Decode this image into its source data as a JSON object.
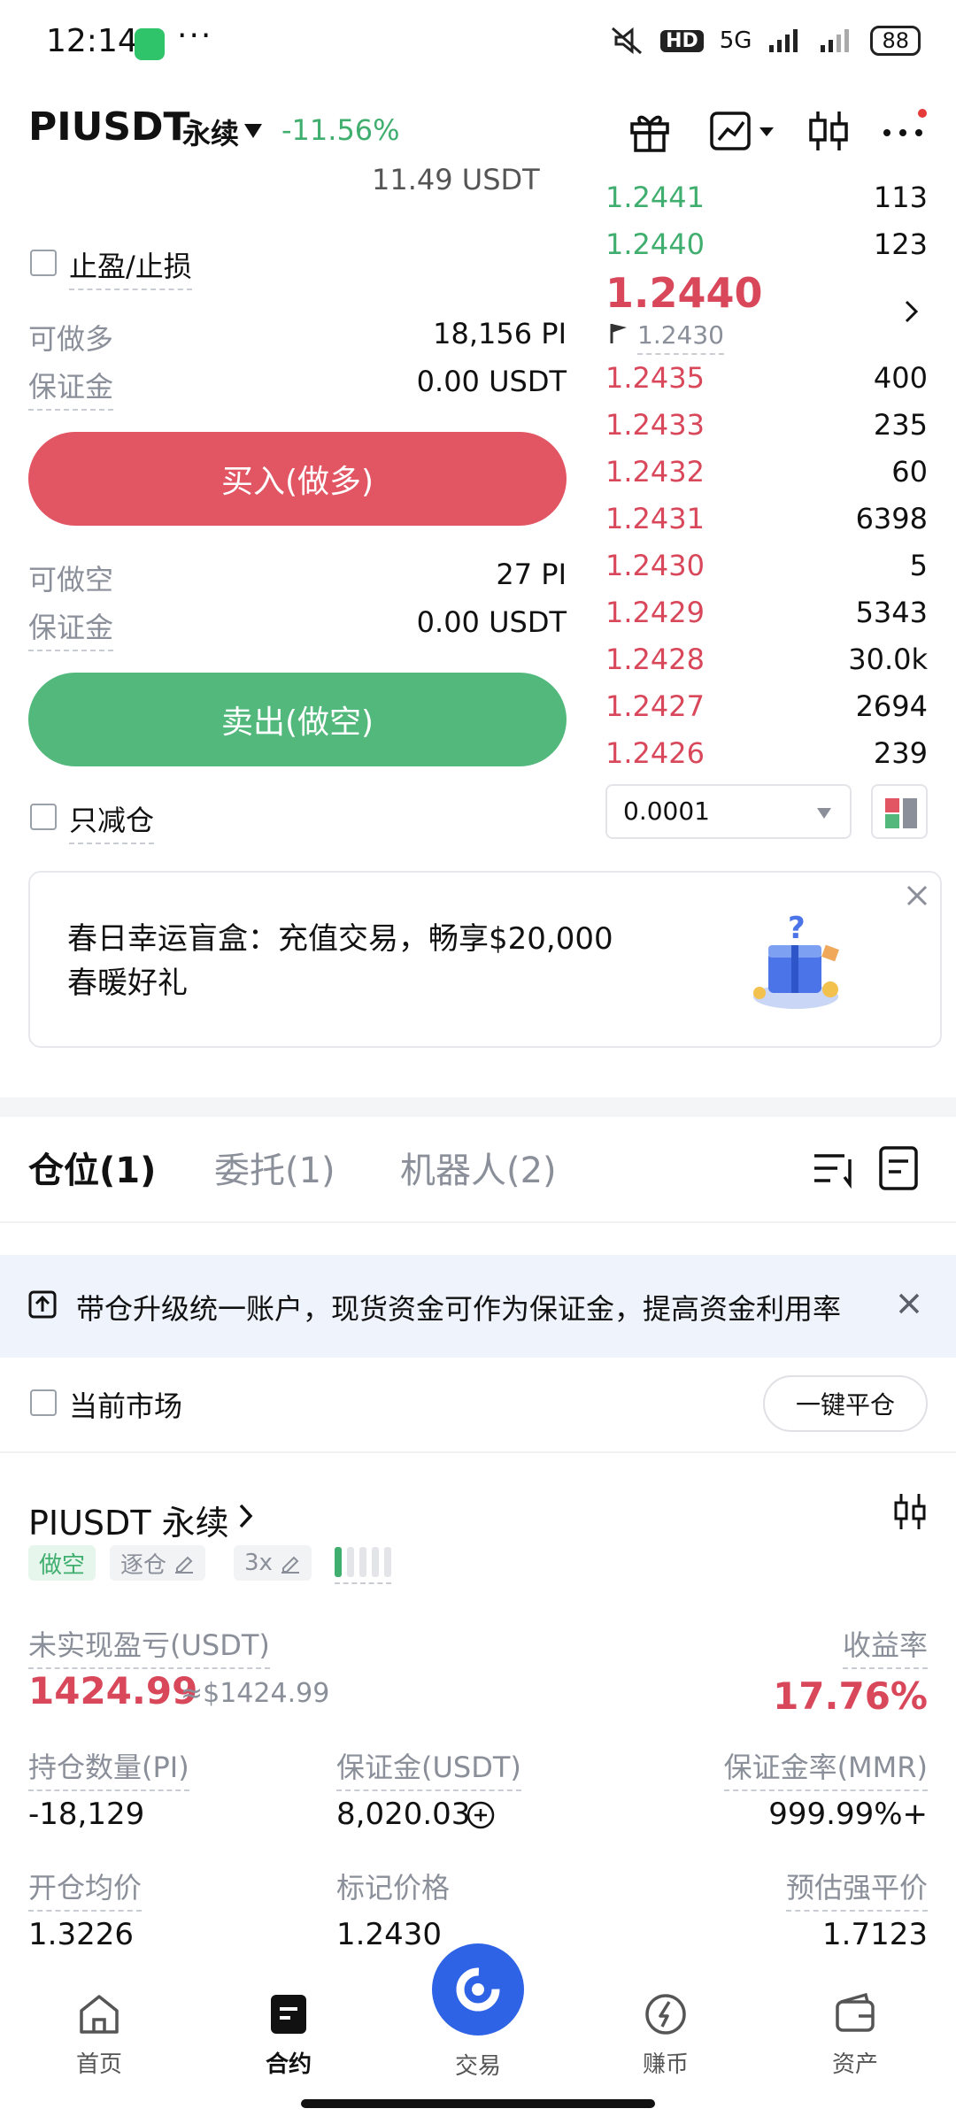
{
  "status_bar": {
    "time": "12:14",
    "network": "5G",
    "hd": "HD",
    "battery": "88"
  },
  "header": {
    "pair": "PIUSDT",
    "contract_type": "永续",
    "change": "-11.56%"
  },
  "form": {
    "partial_top": "11.49 USDT",
    "tp_sl_label": "止盈/止损",
    "long": {
      "avail_label": "可做多",
      "avail_value": "18,156 PI",
      "margin_label": "保证金",
      "margin_value": "0.00 USDT",
      "button": "买入(做多)"
    },
    "short": {
      "avail_label": "可做空",
      "avail_value": "27 PI",
      "margin_label": "保证金",
      "margin_value": "0.00 USDT",
      "button": "卖出(做空)"
    },
    "reduce_only_label": "只减仓"
  },
  "orderbook": {
    "asks": [
      {
        "price": "1.2441",
        "qty": "113"
      },
      {
        "price": "1.2440",
        "qty": "123"
      }
    ],
    "last_price": "1.2440",
    "mark_price": "1.2430",
    "bids": [
      {
        "price": "1.2435",
        "qty": "400"
      },
      {
        "price": "1.2433",
        "qty": "235"
      },
      {
        "price": "1.2432",
        "qty": "60"
      },
      {
        "price": "1.2431",
        "qty": "6398"
      },
      {
        "price": "1.2430",
        "qty": "5"
      },
      {
        "price": "1.2429",
        "qty": "5343"
      },
      {
        "price": "1.2428",
        "qty": "30.0k"
      },
      {
        "price": "1.2427",
        "qty": "2694"
      },
      {
        "price": "1.2426",
        "qty": "239"
      }
    ],
    "precision": "0.0001"
  },
  "promo": {
    "line1": "春日幸运盲盒：充值交易，畅享$20,000",
    "line2": "春暖好礼"
  },
  "tabs": {
    "positions": "仓位(1)",
    "orders": "委托(1)",
    "bots": "机器人(2)"
  },
  "notice": {
    "text": "带仓升级统一账户，现货资金可作为保证金，提高资金利用率"
  },
  "filter": {
    "current_market": "当前市场",
    "close_all": "一键平仓"
  },
  "position": {
    "title": "PIUSDT 永续",
    "side": "做空",
    "margin_mode": "逐仓",
    "leverage": "3x",
    "risk_level": 0.2,
    "unrealized_label": "未实现盈亏(USDT)",
    "unrealized_value": "1424.99",
    "unrealized_usd": "≈$1424.99",
    "roe_label": "收益率",
    "roe_value": "17.76%",
    "size_label": "持仓数量(PI)",
    "size_value": "-18,129",
    "margin_label": "保证金(USDT)",
    "margin_value": "8,020.03",
    "mmr_label": "保证金率(MMR)",
    "mmr_value": "999.99%+",
    "entry_label": "开仓均价",
    "entry_value": "1.3226",
    "mark_label": "标记价格",
    "mark_value": "1.2430",
    "liq_label": "预估强平价",
    "liq_value": "1.7123"
  },
  "nav": {
    "home": "首页",
    "futures": "合约",
    "trade": "交易",
    "earn": "赚币",
    "assets": "资产"
  }
}
